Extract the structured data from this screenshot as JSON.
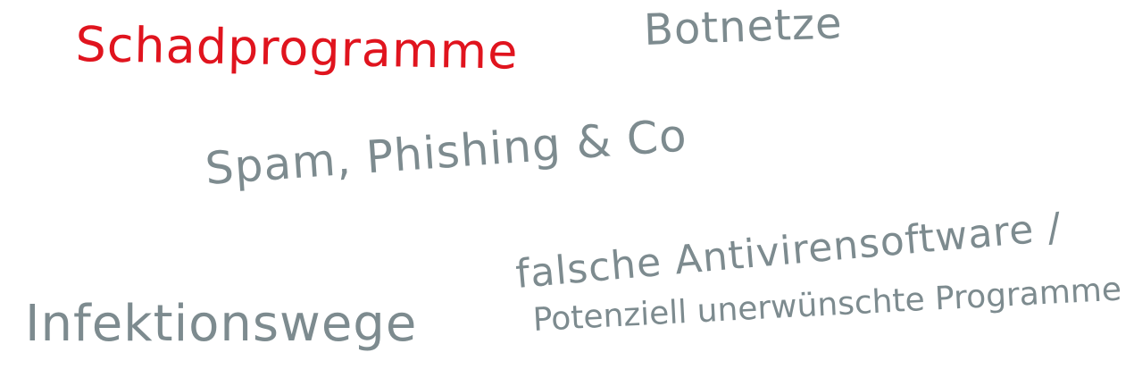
{
  "notes": {
    "malware": "Schadprogramme",
    "botnets": "Botnetze",
    "spam": "Spam, Phishing & Co",
    "infection": "Infektionswege",
    "fake_av": "falsche Antivirensoftware /",
    "pup": "Potenziell unerwünschte Programme"
  },
  "colors": {
    "highlight": "#e0141e",
    "ink": "#7d8b8f"
  }
}
